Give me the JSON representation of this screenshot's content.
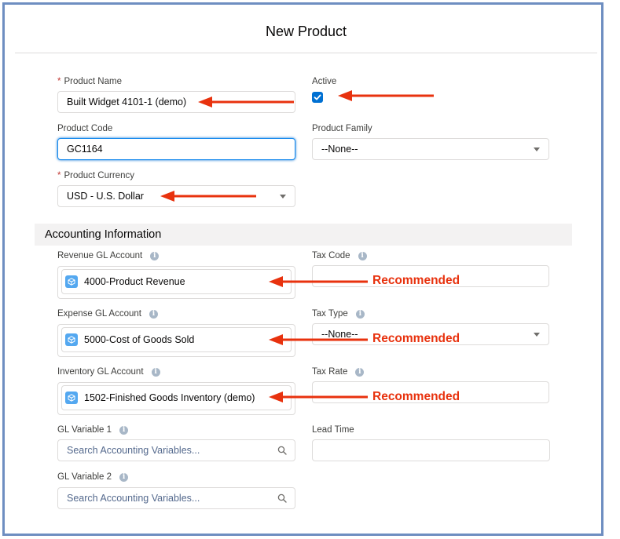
{
  "modal": {
    "title": "New Product"
  },
  "fields": {
    "product_name": {
      "required_mark": "*",
      "label": "Product Name",
      "value": "Built Widget 4101-1 (demo)"
    },
    "active": {
      "label": "Active",
      "checked": true
    },
    "product_code": {
      "label": "Product Code",
      "value": "GC1164"
    },
    "product_family": {
      "label": "Product Family",
      "value": "--None--"
    },
    "product_currency": {
      "required_mark": "*",
      "label": "Product Currency",
      "value": "USD - U.S. Dollar"
    }
  },
  "accounting": {
    "section_title": "Accounting Information",
    "revenue_gl": {
      "label": "Revenue GL Account",
      "value": "4000-Product Revenue"
    },
    "tax_code": {
      "label": "Tax Code",
      "value": ""
    },
    "expense_gl": {
      "label": "Expense GL Account",
      "value": "5000-Cost of Goods Sold"
    },
    "tax_type": {
      "label": "Tax Type",
      "value": "--None--"
    },
    "inventory_gl": {
      "label": "Inventory GL Account",
      "value": "1502-Finished Goods Inventory (demo)"
    },
    "tax_rate": {
      "label": "Tax Rate",
      "value": ""
    },
    "gl_variable_1": {
      "label": "GL Variable 1",
      "placeholder": "Search Accounting Variables..."
    },
    "lead_time": {
      "label": "Lead Time",
      "value": ""
    },
    "gl_variable_2": {
      "label": "GL Variable 2",
      "placeholder": "Search Accounting Variables..."
    }
  },
  "annotations": {
    "recommended_label": "Recommended",
    "arrow_color": "#e8320e"
  },
  "colors": {
    "accent": "#0070d2",
    "frame": "#6e8ec1",
    "lookup_icon": "#54a8f0"
  },
  "icons": {
    "info": "info-icon",
    "lookup": "cube-icon",
    "search": "search-icon",
    "checkbox": "checkmark-icon",
    "select": "chevron-down-icon"
  }
}
